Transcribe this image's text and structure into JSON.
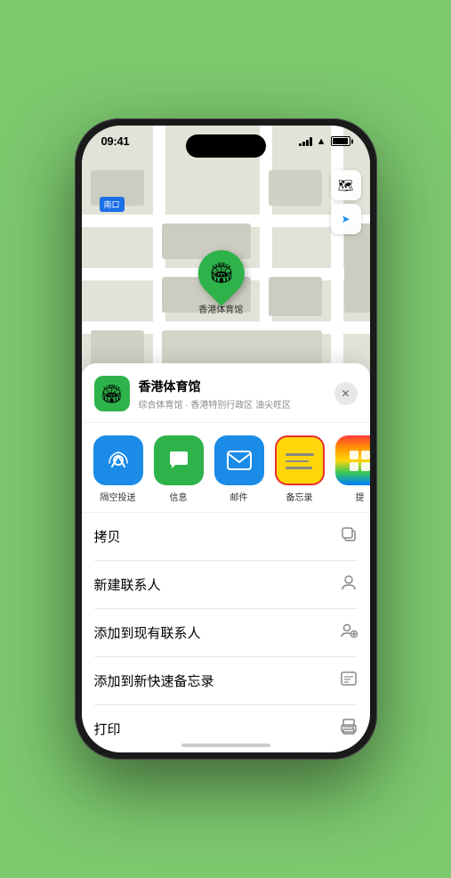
{
  "status": {
    "time": "09:41",
    "location_arrow": "▶"
  },
  "map": {
    "label_text": "南口",
    "venue_pin_label": "香港体育馆",
    "venue_pin_emoji": "🏟"
  },
  "map_controls": {
    "map_btn_label": "🗺",
    "location_btn_label": "➤"
  },
  "venue_card": {
    "name": "香港体育馆",
    "subtitle": "综合体育馆 · 香港特别行政区 油尖旺区",
    "close_label": "✕",
    "venue_emoji": "🏟"
  },
  "share_items": [
    {
      "id": "airdrop",
      "label": "隔空投送",
      "class": "airdrop",
      "icon_type": "airdrop"
    },
    {
      "id": "messages",
      "label": "信息",
      "class": "messages",
      "icon_type": "messages"
    },
    {
      "id": "mail",
      "label": "邮件",
      "class": "mail",
      "icon_type": "mail"
    },
    {
      "id": "notes",
      "label": "备忘录",
      "class": "notes",
      "icon_type": "notes"
    },
    {
      "id": "more",
      "label": "提",
      "class": "more",
      "icon_type": "more"
    }
  ],
  "actions": [
    {
      "id": "copy",
      "label": "拷贝",
      "icon": "⧉"
    },
    {
      "id": "new-contact",
      "label": "新建联系人",
      "icon": "👤"
    },
    {
      "id": "add-existing",
      "label": "添加到现有联系人",
      "icon": "👤"
    },
    {
      "id": "add-notes",
      "label": "添加到新快速备忘录",
      "icon": "📋"
    },
    {
      "id": "print",
      "label": "打印",
      "icon": "🖨"
    }
  ]
}
